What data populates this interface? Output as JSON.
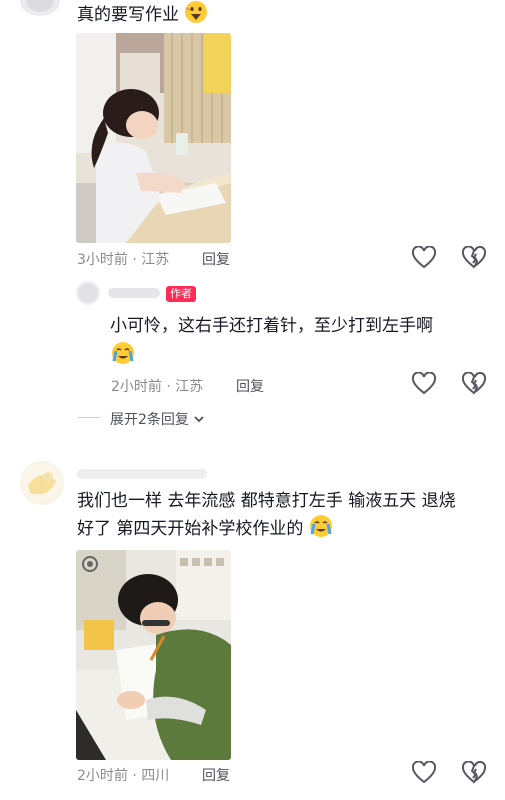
{
  "comments": [
    {
      "text": "真的要写作业",
      "time_location": "3小时前 · 江苏",
      "reply_label": "回复"
    },
    {
      "text_line1": "我们也一样 去年流感 都特意打左手 输液五天 退烧",
      "text_line2": "好了 第四天开始补学校作业的",
      "time_location": "2小时前 · 四川",
      "reply_label": "回复"
    }
  ],
  "reply": {
    "author_badge": "作者",
    "text": "小可怜，这右手还打着针，至少打到左手啊",
    "time_location": "2小时前 · 江苏",
    "reply_label": "回复"
  },
  "expand_label": "展开2条回复"
}
